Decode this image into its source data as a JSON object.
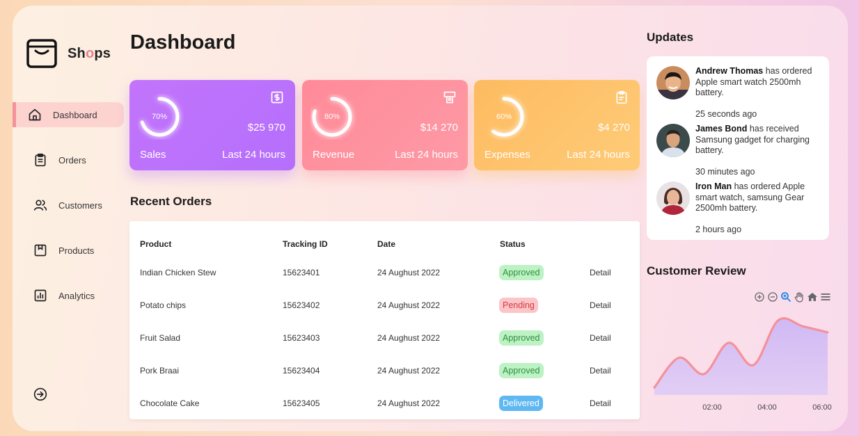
{
  "app": {
    "name_prefix": "Sh",
    "name_accent": "o",
    "name_suffix": "ps"
  },
  "sidebar": {
    "items": [
      {
        "label": "Dashboard",
        "icon": "home-icon",
        "active": true
      },
      {
        "label": "Orders",
        "icon": "clipboard-icon"
      },
      {
        "label": "Customers",
        "icon": "users-icon"
      },
      {
        "label": "Products",
        "icon": "box-icon"
      },
      {
        "label": "Analytics",
        "icon": "bar-chart-icon"
      }
    ],
    "logout_icon": "logout-icon"
  },
  "page": {
    "title": "Dashboard"
  },
  "cards": [
    {
      "name": "Sales",
      "percent_label": "70%",
      "percent": 70,
      "amount": "$25 970",
      "period": "Last 24 hours",
      "icon": "dollar-icon"
    },
    {
      "name": "Revenue",
      "percent_label": "80%",
      "percent": 80,
      "amount": "$14 270",
      "period": "Last 24 hours",
      "icon": "wallet-icon"
    },
    {
      "name": "Expenses",
      "percent_label": "60%",
      "percent": 60,
      "amount": "$4 270",
      "period": "Last 24 hours",
      "icon": "receipt-icon"
    }
  ],
  "orders": {
    "title": "Recent Orders",
    "headers": [
      "Product",
      "Tracking ID",
      "Date",
      "Status"
    ],
    "rows": [
      {
        "product": "Indian Chicken Stew",
        "tracking": "15623401",
        "date": "24 Aughust 2022",
        "status": "Approved",
        "action": "Detail"
      },
      {
        "product": "Potato chips",
        "tracking": "15623402",
        "date": "24 Aughust 2022",
        "status": "Pending",
        "action": "Detail"
      },
      {
        "product": "Fruit Salad",
        "tracking": "15623403",
        "date": "24 Aughust 2022",
        "status": "Approved",
        "action": "Detail"
      },
      {
        "product": "Pork Braai",
        "tracking": "15623404",
        "date": "24 Aughust 2022",
        "status": "Approved",
        "action": "Detail"
      },
      {
        "product": "Chocolate Cake",
        "tracking": "15623405",
        "date": "24 Aughust 2022",
        "status": "Delivered",
        "action": "Detail"
      }
    ],
    "status_colors": {
      "Approved": "#bdf2c4",
      "Pending": "#fcc5c7",
      "Delivered": "#5fb8f2"
    }
  },
  "updates": {
    "title": "Updates",
    "items": [
      {
        "name": "Andrew Thomas",
        "text": " has ordered Apple smart watch 2500mh battery.",
        "time": "25 seconds ago"
      },
      {
        "name": "James Bond",
        "text": " has received Samsung gadget for charging battery.",
        "time": "30 minutes ago"
      },
      {
        "name": "Iron Man",
        "text": " has ordered Apple smart watch, samsung Gear 2500mh battery.",
        "time": "2 hours ago"
      }
    ]
  },
  "review": {
    "title": "Customer Review",
    "toolbar": [
      "zoom-in-icon",
      "zoom-out-icon",
      "magnifier-icon",
      "pan-hand-icon",
      "home-icon",
      "menu-icon"
    ]
  },
  "chart_data": {
    "type": "area",
    "x_ticks": [
      "02:00",
      "04:00",
      "06:00"
    ],
    "x": [
      0,
      1,
      2,
      3,
      4,
      5,
      6,
      7
    ],
    "values": [
      10,
      50,
      28,
      70,
      40,
      100,
      92,
      84
    ],
    "ylim": [
      0,
      110
    ],
    "line_color": "#f4919a",
    "fill_color": "#c9b2f6"
  }
}
